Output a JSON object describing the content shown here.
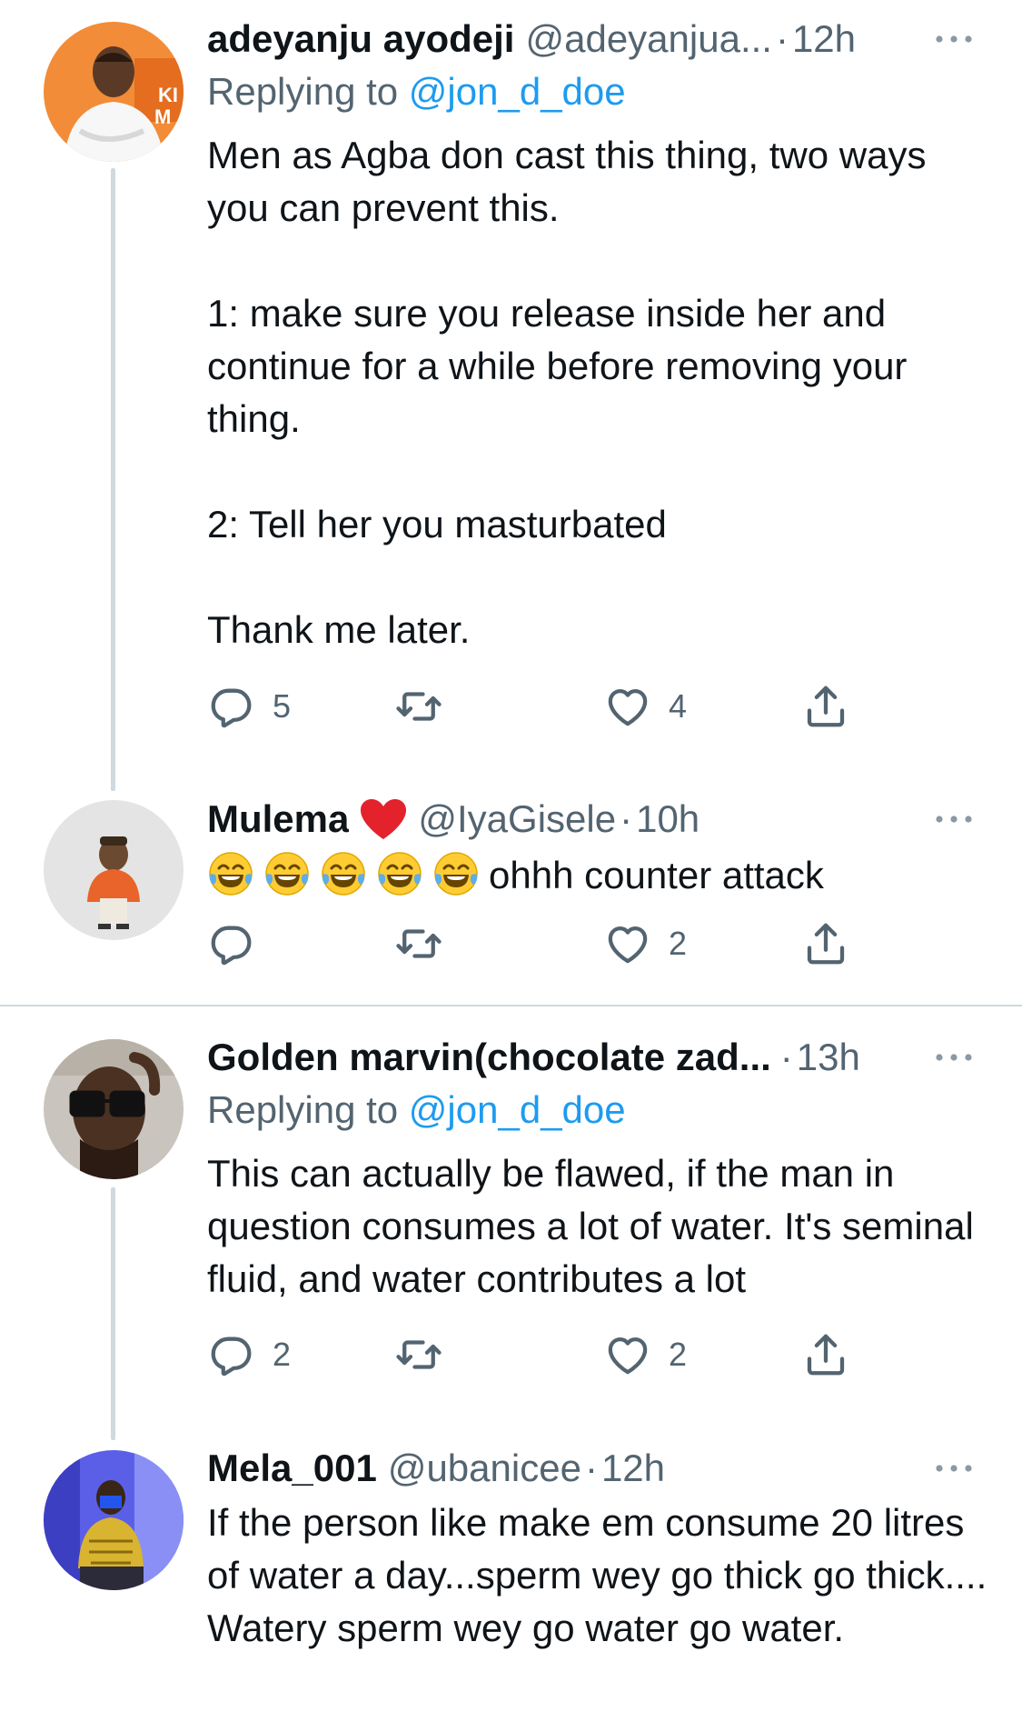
{
  "replies": [
    {
      "display_name": "adeyanju ayodeji",
      "handle": "@adeyanjua...",
      "dot": "·",
      "time": "12h",
      "replying_prefix": "Replying to",
      "replying_to": "@jon_d_doe",
      "text": "Men as Agba don cast this thing, two ways you can prevent this.\n\n1: make sure you release inside her and continue for a while before removing your thing.\n\n2: Tell her you masturbated\n\nThank me later.",
      "reply_count": "5",
      "retweet_count": "",
      "like_count": "4"
    },
    {
      "display_name": "Mulema",
      "handle": "@IyaGisele",
      "dot": "·",
      "time": "10h",
      "emoji_count": 5,
      "text": "ohhh counter attack",
      "reply_count": "",
      "retweet_count": "",
      "like_count": "2"
    },
    {
      "display_name": "Golden marvin(chocolate zad...",
      "handle": "",
      "dot": "·",
      "time": "13h",
      "replying_prefix": "Replying to",
      "replying_to": "@jon_d_doe",
      "text": "This can actually be flawed, if the man in question consumes a lot of water. It's seminal fluid, and water contributes a lot",
      "reply_count": "2",
      "retweet_count": "",
      "like_count": "2"
    },
    {
      "display_name": "Mela_001",
      "handle": "@ubanicee",
      "dot": "·",
      "time": "12h",
      "text": "If the person like make em consume 20 litres of water a day...sperm wey go thick go thick.... Watery sperm wey go water go water."
    }
  ],
  "colors": {
    "text": "#0f1419",
    "secondary": "#536471",
    "link": "#1d9bf0",
    "divider": "#cfd9de"
  },
  "icons": [
    "more-icon",
    "reply-icon",
    "retweet-icon",
    "like-icon",
    "share-icon",
    "red-heart-emoji",
    "laughing-tears-emoji"
  ]
}
